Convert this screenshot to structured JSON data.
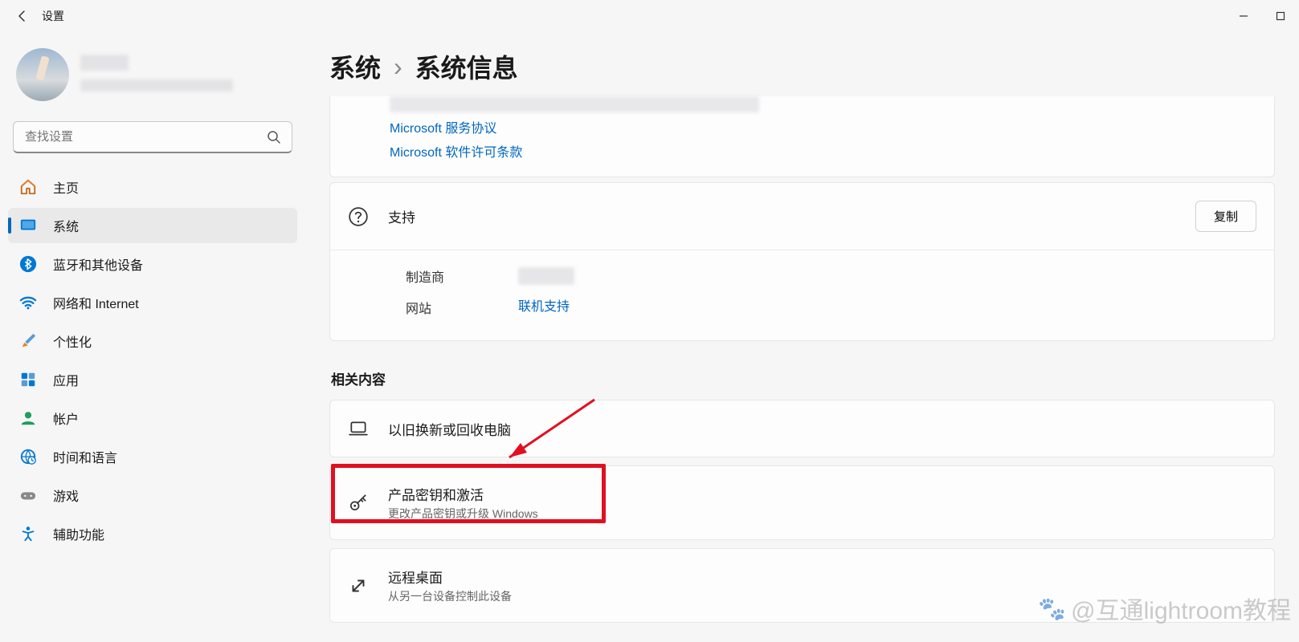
{
  "window": {
    "title": "设置"
  },
  "search": {
    "placeholder": "查找设置"
  },
  "breadcrumb": {
    "parent": "系统",
    "sep": "›",
    "current": "系统信息"
  },
  "nav": {
    "items": [
      {
        "label": "主页"
      },
      {
        "label": "系统"
      },
      {
        "label": "蓝牙和其他设备"
      },
      {
        "label": "网络和 Internet"
      },
      {
        "label": "个性化"
      },
      {
        "label": "应用"
      },
      {
        "label": "帐户"
      },
      {
        "label": "时间和语言"
      },
      {
        "label": "游戏"
      },
      {
        "label": "辅助功能"
      }
    ]
  },
  "spec_card": {
    "link1": "Microsoft 服务协议",
    "link2": "Microsoft 软件许可条款"
  },
  "support": {
    "title": "支持",
    "copy": "复制",
    "rows": {
      "manufacturer_label": "制造商",
      "website_label": "网站",
      "website_link": "联机支持"
    }
  },
  "related": {
    "heading": "相关内容",
    "items": [
      {
        "title": "以旧换新或回收电脑",
        "subtitle": ""
      },
      {
        "title": "产品密钥和激活",
        "subtitle": "更改产品密钥或升级 Windows"
      },
      {
        "title": "远程桌面",
        "subtitle": "从另一台设备控制此设备"
      }
    ]
  },
  "watermark": "@互通lightroom教程"
}
